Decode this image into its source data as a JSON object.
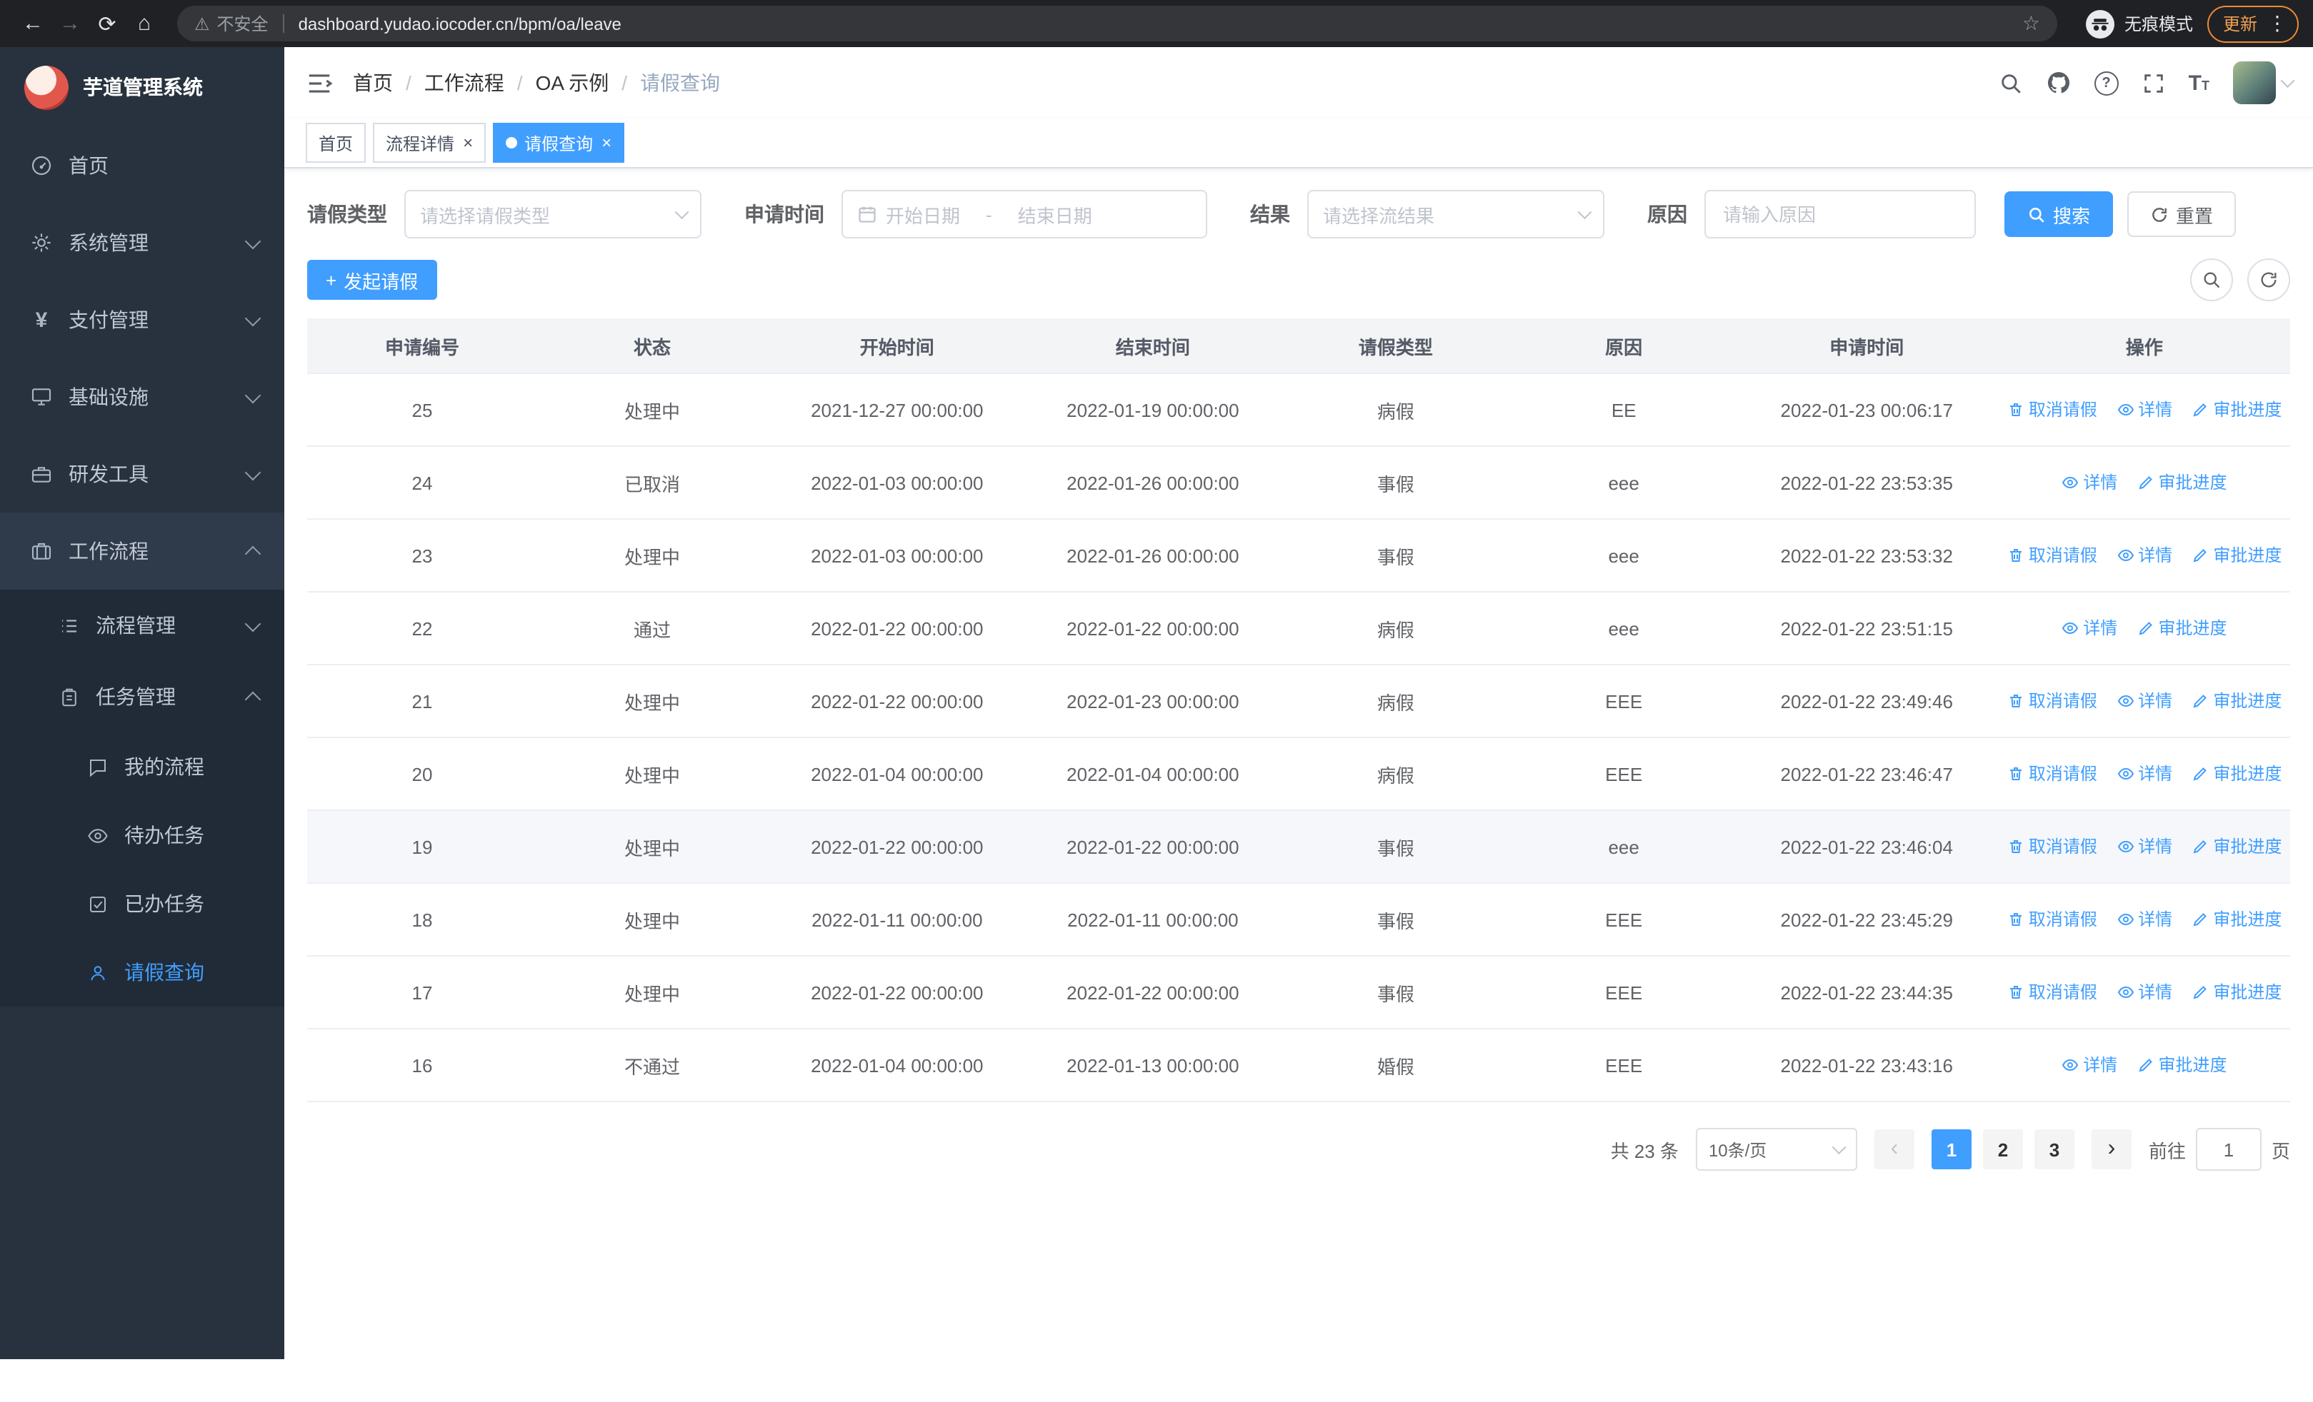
{
  "browser": {
    "security_warning": "不安全",
    "url": "dashboard.yudao.iocoder.cn/bpm/oa/leave",
    "incognito_label": "无痕模式",
    "update_label": "更新"
  },
  "icons": {
    "back": "←",
    "forward": "→",
    "reload": "⟳",
    "home": "⌂",
    "warning": "⚠",
    "star": "☆",
    "more": "⋮",
    "close": "×",
    "breadcrumb_sep": "/",
    "plus": "+",
    "yen": "¥",
    "prev": "‹",
    "next": "›",
    "text_size": "T"
  },
  "sidebar": {
    "logo_title": "芋道管理系统",
    "items": [
      {
        "label": "首页",
        "icon": "dashboard-icon"
      },
      {
        "label": "系统管理",
        "icon": "gear-icon"
      },
      {
        "label": "支付管理",
        "icon": "yen-icon"
      },
      {
        "label": "基础设施",
        "icon": "infrastructure-icon"
      },
      {
        "label": "研发工具",
        "icon": "tools-icon"
      },
      {
        "label": "工作流程",
        "icon": "workflow-icon",
        "expanded": true
      }
    ],
    "workflow_children": [
      {
        "label": "流程管理",
        "icon": "process-list-icon"
      },
      {
        "label": "任务管理",
        "icon": "task-icon",
        "expanded": true
      }
    ],
    "task_children": [
      {
        "label": "我的流程",
        "icon": "chat-icon"
      },
      {
        "label": "待办任务",
        "icon": "eye-icon"
      },
      {
        "label": "已办任务",
        "icon": "done-icon"
      },
      {
        "label": "请假查询",
        "icon": "user-icon",
        "active": true
      }
    ]
  },
  "header": {
    "breadcrumb": [
      "首页",
      "工作流程",
      "OA 示例",
      "请假查询"
    ]
  },
  "tabs": [
    {
      "label": "首页"
    },
    {
      "label": "流程详情",
      "closable": true
    },
    {
      "label": "请假查询",
      "closable": true,
      "active": true,
      "dot": true
    }
  ],
  "filters": {
    "leave_type_label": "请假类型",
    "leave_type_placeholder": "请选择请假类型",
    "apply_time_label": "申请时间",
    "start_date_placeholder": "开始日期",
    "date_separator": "-",
    "end_date_placeholder": "结束日期",
    "result_label": "结果",
    "result_placeholder": "请选择流结果",
    "reason_label": "原因",
    "reason_placeholder": "请输入原因",
    "search_label": "搜索",
    "reset_label": "重置"
  },
  "toolbar": {
    "create_label": "发起请假"
  },
  "table": {
    "columns": [
      "申请编号",
      "状态",
      "开始时间",
      "结束时间",
      "请假类型",
      "原因",
      "申请时间",
      "操作"
    ],
    "ops": {
      "cancel": "取消请假",
      "detail": "详情",
      "progress": "审批进度"
    },
    "rows": [
      {
        "id": "25",
        "status": "处理中",
        "start": "2021-12-27 00:00:00",
        "end": "2022-01-19 00:00:00",
        "type": "病假",
        "reason": "EE",
        "applied": "2022-01-23 00:06:17",
        "can_cancel": true
      },
      {
        "id": "24",
        "status": "已取消",
        "start": "2022-01-03 00:00:00",
        "end": "2022-01-26 00:00:00",
        "type": "事假",
        "reason": "eee",
        "applied": "2022-01-22 23:53:35",
        "can_cancel": false
      },
      {
        "id": "23",
        "status": "处理中",
        "start": "2022-01-03 00:00:00",
        "end": "2022-01-26 00:00:00",
        "type": "事假",
        "reason": "eee",
        "applied": "2022-01-22 23:53:32",
        "can_cancel": true
      },
      {
        "id": "22",
        "status": "通过",
        "start": "2022-01-22 00:00:00",
        "end": "2022-01-22 00:00:00",
        "type": "病假",
        "reason": "eee",
        "applied": "2022-01-22 23:51:15",
        "can_cancel": false
      },
      {
        "id": "21",
        "status": "处理中",
        "start": "2022-01-22 00:00:00",
        "end": "2022-01-23 00:00:00",
        "type": "病假",
        "reason": "EEE",
        "applied": "2022-01-22 23:49:46",
        "can_cancel": true
      },
      {
        "id": "20",
        "status": "处理中",
        "start": "2022-01-04 00:00:00",
        "end": "2022-01-04 00:00:00",
        "type": "病假",
        "reason": "EEE",
        "applied": "2022-01-22 23:46:47",
        "can_cancel": true
      },
      {
        "id": "19",
        "status": "处理中",
        "start": "2022-01-22 00:00:00",
        "end": "2022-01-22 00:00:00",
        "type": "事假",
        "reason": "eee",
        "applied": "2022-01-22 23:46:04",
        "can_cancel": true,
        "highlight": true
      },
      {
        "id": "18",
        "status": "处理中",
        "start": "2022-01-11 00:00:00",
        "end": "2022-01-11 00:00:00",
        "type": "事假",
        "reason": "EEE",
        "applied": "2022-01-22 23:45:29",
        "can_cancel": true
      },
      {
        "id": "17",
        "status": "处理中",
        "start": "2022-01-22 00:00:00",
        "end": "2022-01-22 00:00:00",
        "type": "事假",
        "reason": "EEE",
        "applied": "2022-01-22 23:44:35",
        "can_cancel": true
      },
      {
        "id": "16",
        "status": "不通过",
        "start": "2022-01-04 00:00:00",
        "end": "2022-01-13 00:00:00",
        "type": "婚假",
        "reason": "EEE",
        "applied": "2022-01-22 23:43:16",
        "can_cancel": false
      }
    ]
  },
  "pagination": {
    "total_label": "共 23 条",
    "page_size": "10条/页",
    "pages": [
      {
        "label": "1",
        "active": true
      },
      {
        "label": "2"
      },
      {
        "label": "3"
      }
    ],
    "goto_label": "前往",
    "goto_value": "1",
    "page_suffix": "页"
  },
  "colors": {
    "primary": "#409eff",
    "chrome_bg": "#202124",
    "sidebar_bg": "#28323E",
    "sidebar_submenu_bg": "#212B37",
    "update_accent": "#ed8936",
    "table_header_bg": "#f3f4f6"
  }
}
